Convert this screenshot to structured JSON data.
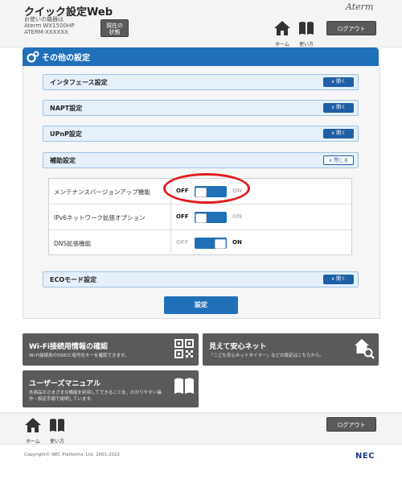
{
  "header": {
    "title": "クイック設定Web",
    "device_lines": [
      "お使いの機器は",
      "Aterm WX1500HP",
      "ATERM-XXXXXX"
    ],
    "status_button": [
      "現在の",
      "状態"
    ],
    "brand": "Aterm",
    "nav": {
      "home": "ホーム",
      "help": "使い方"
    },
    "logout": "ログアウト"
  },
  "panel": {
    "title": "その他の設定",
    "sections": [
      {
        "label": "インタフェース設定",
        "button": "開く"
      },
      {
        "label": "NAPT設定",
        "button": "開く"
      },
      {
        "label": "UPnP設定",
        "button": "開く"
      },
      {
        "label": "補助設定",
        "button": "閉じる"
      },
      {
        "label": "ECOモード設定",
        "button": "開く"
      }
    ],
    "rows": [
      {
        "name": "メンテナンスバージョンアップ機能",
        "state": "OFF"
      },
      {
        "name": "IPv6ネットワーク拡張オプション",
        "state": "OFF"
      },
      {
        "name": "DNS拡張機能",
        "state": "ON"
      }
    ],
    "toggle_off_label": "OFF",
    "toggle_on_label": "ON",
    "submit": "設定"
  },
  "tiles": {
    "wifi": {
      "title": "Wi-Fi接続用情報の確認",
      "desc": "Wi-Fi接続用のSSIDと暗号化キーを確認できます。"
    },
    "anshin": {
      "title": "見えて安心ネット",
      "desc": "「こども安心ネットタイマー」などの設定はこちらから。"
    },
    "manual": {
      "title": "ユーザーズマニュアル",
      "desc": [
        "本商品のさまざまな機能を利用してできることを、わかりやすい操",
        "作・設定手順で説明しています。"
      ]
    }
  },
  "footer": {
    "home": "ホーム",
    "help": "使い方",
    "logout": "ログアウト",
    "copyright": "Copyright© NEC Platforms, Ltd. 2001-2022",
    "nec": "NEC"
  },
  "colors": {
    "accent": "#2070b8",
    "highlight": "#e01b1b",
    "tile": "#5a5a5a"
  }
}
